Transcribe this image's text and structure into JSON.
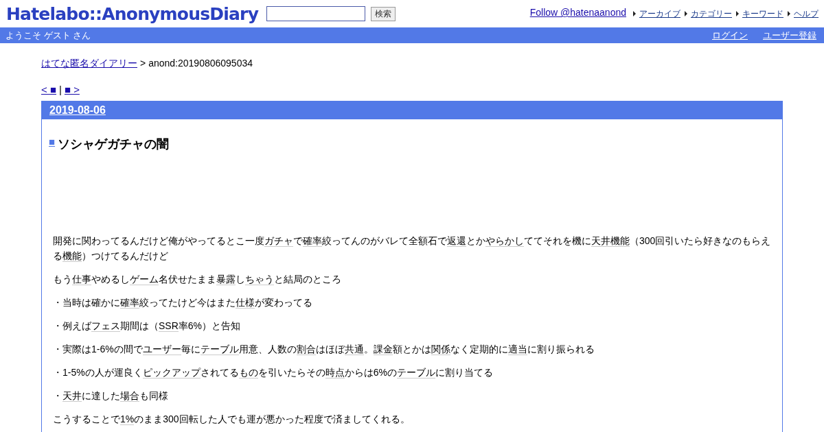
{
  "header": {
    "logo": "Hatelabo::AnonymousDiary",
    "search": {
      "button": "検索"
    },
    "follow": "Follow @hatenaanond",
    "nav": [
      "アーカイブ",
      "カテゴリー",
      "キーワード",
      "ヘルプ"
    ]
  },
  "welcome_bar": {
    "greeting": "ようこそ ゲスト さん",
    "links": [
      "ログイン",
      "ユーザー登録"
    ]
  },
  "breadcrumb": {
    "home": "はてな匿名ダイアリー",
    "separator": ">",
    "current": "anond:20190806095034"
  },
  "pager": {
    "prev": "< ■",
    "separator": "|",
    "next": "■ >"
  },
  "entry": {
    "date": "2019-08-06",
    "title_mark": "■",
    "title": "ソシャゲガチャの闇",
    "paragraphs": [
      [
        {
          "t": "開発に関わってるんだけど俺がやってるとこ一度"
        },
        {
          "t": "ガチャ",
          "link": true
        },
        {
          "t": "で"
        },
        {
          "t": "確率",
          "link": true
        },
        {
          "t": "絞ってんのがバレて全額石で"
        },
        {
          "t": "返還",
          "link": true
        },
        {
          "t": "とか"
        },
        {
          "t": "やらかし",
          "link": true
        },
        {
          "t": "ててそれを機に"
        },
        {
          "t": "天井機能",
          "link": true
        },
        {
          "t": "（300回引いたら好きなのもらえる"
        },
        {
          "t": "機能",
          "link": true
        },
        {
          "t": "）つけてるんだけど"
        }
      ],
      [
        {
          "t": "もう"
        },
        {
          "t": "仕事",
          "link": true
        },
        {
          "t": "やめるし"
        },
        {
          "t": "ゲーム",
          "link": true
        },
        {
          "t": "名伏せたまま"
        },
        {
          "t": "暴露",
          "link": true
        },
        {
          "t": "し"
        },
        {
          "t": "ちゃう",
          "link": true
        },
        {
          "t": "と結局のところ"
        }
      ],
      [
        {
          "t": "・当時は確かに"
        },
        {
          "t": "確率",
          "link": true
        },
        {
          "t": "絞ってたけど今はまた"
        },
        {
          "t": "仕様",
          "link": true
        },
        {
          "t": "が変わってる"
        }
      ],
      [
        {
          "t": "・例えば"
        },
        {
          "t": "フェス",
          "link": true
        },
        {
          "t": "期間は（"
        },
        {
          "t": "SSR",
          "link": true
        },
        {
          "t": "率6%）と告知"
        }
      ],
      [
        {
          "t": "・実際は1-6%の間で"
        },
        {
          "t": "ユーザー",
          "link": true
        },
        {
          "t": "毎に"
        },
        {
          "t": "テーブル",
          "link": true
        },
        {
          "t": "用意、人数の"
        },
        {
          "t": "割合",
          "link": true
        },
        {
          "t": "はほぼ"
        },
        {
          "t": "共通",
          "link": true
        },
        {
          "t": "。"
        },
        {
          "t": "課金",
          "link": true
        },
        {
          "t": "額とかは"
        },
        {
          "t": "関係",
          "link": true
        },
        {
          "t": "なく定期的に"
        },
        {
          "t": "適当",
          "link": true
        },
        {
          "t": "に割り振られる"
        }
      ],
      [
        {
          "t": "・1-5%の人が運良く"
        },
        {
          "t": "ピックアップ",
          "link": true
        },
        {
          "t": "されてる"
        },
        {
          "t": "もの",
          "link": true
        },
        {
          "t": "を引いたらその"
        },
        {
          "t": "時点",
          "link": true
        },
        {
          "t": "からは6%の"
        },
        {
          "t": "テーブル",
          "link": true
        },
        {
          "t": "に割り当てる"
        }
      ],
      [
        {
          "t": "・"
        },
        {
          "t": "天井",
          "link": true
        },
        {
          "t": "に達した"
        },
        {
          "t": "場合",
          "link": true
        },
        {
          "t": "も同様"
        }
      ],
      [
        {
          "t": "こうすることで"
        },
        {
          "t": "1%",
          "link": true
        },
        {
          "t": "のまま300回転した人でも運が悪かった程度で済ましてくれる。"
        }
      ]
    ]
  }
}
